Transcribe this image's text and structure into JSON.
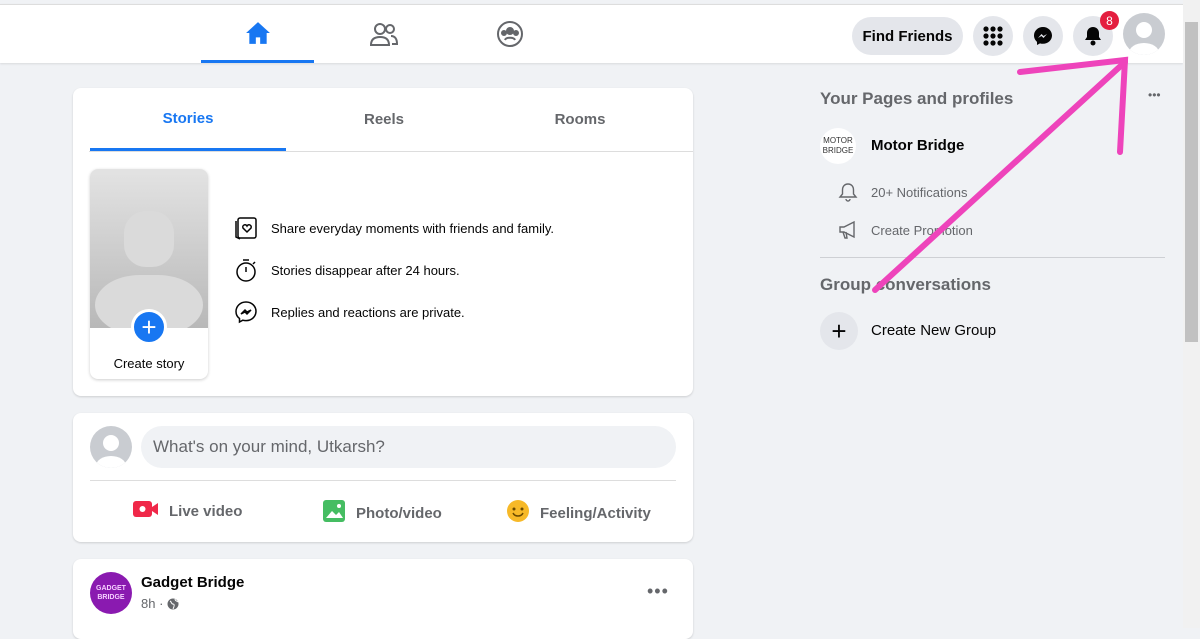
{
  "header": {
    "find_friends": "Find Friends",
    "notification_count": "8"
  },
  "stories": {
    "tabs": [
      "Stories",
      "Reels",
      "Rooms"
    ],
    "create_story": "Create story",
    "info": [
      "Share everyday moments with friends and family.",
      "Stories disappear after 24 hours.",
      "Replies and reactions are private."
    ]
  },
  "composer": {
    "placeholder": "What's on your mind, Utkarsh?",
    "actions": [
      "Live video",
      "Photo/video",
      "Feeling/Activity"
    ]
  },
  "post": {
    "author": "Gadget Bridge",
    "time": "8h",
    "avatar_text": "GADGET BRIDGE"
  },
  "right": {
    "pages_title": "Your Pages and profiles",
    "page_name": "Motor Bridge",
    "page_logo": "MOTOR BRIDGE",
    "notifications": "20+ Notifications",
    "create_promotion": "Create Promotion",
    "groups_title": "Group conversations",
    "create_group": "Create New Group"
  },
  "colors": {
    "accent": "#1877f2",
    "annotation": "#ee44bb"
  }
}
